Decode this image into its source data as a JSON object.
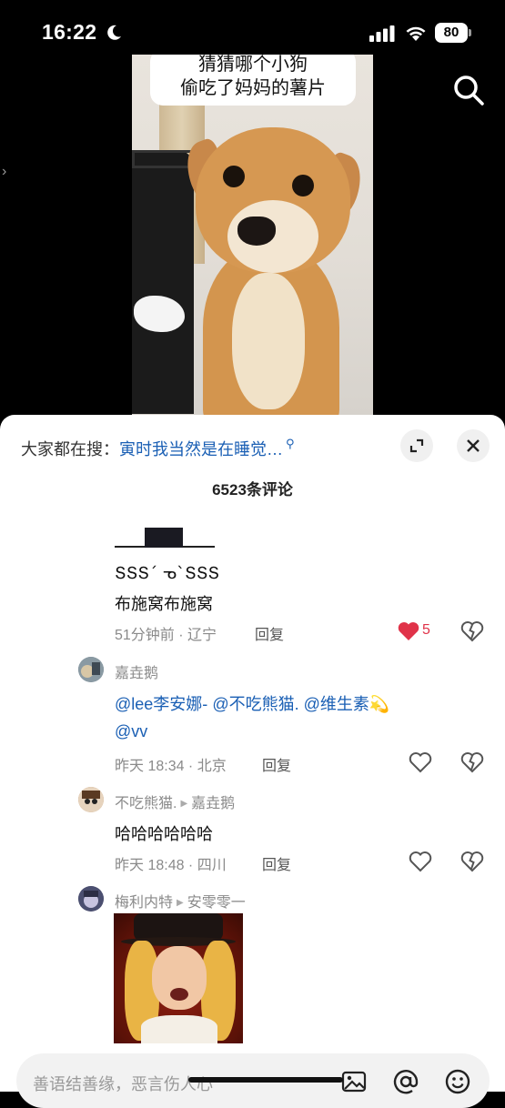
{
  "status_bar": {
    "time": "16:22",
    "battery": "80"
  },
  "video": {
    "caption_line1": "猜猜哪个小狗",
    "caption_line2": "偷吃了妈妈的薯片"
  },
  "comments_panel": {
    "trending_prefix": "大家都在搜：",
    "trending_keyword": "寅时我当然是在睡觉…",
    "count_label": "6523条评论"
  },
  "comments": {
    "first": {
      "kaomoji": "ՏՏՏ´ ᓀ`ՏՏՏ",
      "text": "布施窝布施窝",
      "meta": "51分钟前 · 辽宁",
      "reply": "回复",
      "likes": "5"
    },
    "second": {
      "author": "嘉垚鹅",
      "mention1": "@lee李安娜-",
      "mention2": "@不吃熊猫.",
      "mention3": "@维生素💫",
      "mention4": "@vv",
      "meta": "昨天 18:34 · 北京",
      "reply": "回复"
    },
    "third": {
      "author": "不吃熊猫.",
      "reply_to": "嘉垚鹅",
      "text": "哈哈哈哈哈哈",
      "meta": "昨天 18:48 · 四川",
      "reply": "回复"
    },
    "fourth": {
      "author": "梅利内特",
      "reply_to": "安零零一"
    }
  },
  "input": {
    "placeholder": "善语结善缘，恶言伤人心"
  },
  "colors": {
    "mention": "#1a5fb4",
    "like_red": "#e03349"
  }
}
